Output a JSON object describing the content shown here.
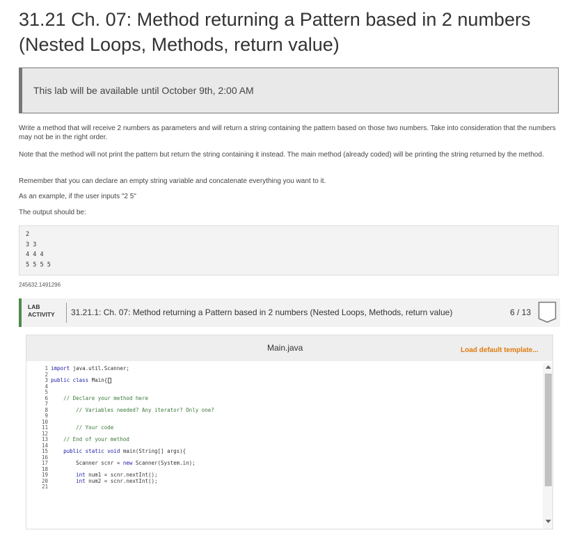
{
  "page": {
    "title_line1": "31.21 Ch. 07: Method returning a Pattern based in 2 numbers",
    "title_line2": "(Nested Loops, Methods, return value)"
  },
  "notice": {
    "text": "This lab will be available until October 9th, 2:00 AM"
  },
  "description": {
    "p1": "Write a method that will receive 2 numbers as parameters and will return a string containing the pattern based on those two numbers. Take into consideration that the numbers may not be in the right order.",
    "p2": "Note that the method will not print the pattern but return the string containing it instead. The main method (already coded) will be printing the string returned by the method.",
    "p3": "Remember that you can declare an empty string variable and concatenate everything you want to it.",
    "p4": "As an example, if the user inputs \"2 5\"",
    "p5": "The output should be:"
  },
  "example_output": [
    "2",
    "3 3",
    "4 4 4",
    "5 5 5 5"
  ],
  "lab_id": "245632.1491296",
  "lab": {
    "tag_line1": "LAB",
    "tag_line2": "ACTIVITY",
    "title": "31.21.1: Ch. 07: Method returning a Pattern based in 2 numbers (Nested Loops, Methods, return value)",
    "score": "6 / 13",
    "badge_icon": "ribbon-icon"
  },
  "editor": {
    "filename": "Main.java",
    "load_default": "Load default template...",
    "line_numbers": [
      "1",
      "2",
      "3",
      "4",
      "5",
      "6",
      "7",
      "8",
      "9",
      "10",
      "11",
      "12",
      "13",
      "14",
      "15",
      "16",
      "17",
      "18",
      "19",
      "20",
      "21"
    ],
    "lines": [
      "import java.util.Scanner;",
      "",
      "public class Main{",
      "",
      "",
      "    // Declare your method here",
      "",
      "        // Variables needed? Any iterator? Only one?",
      "",
      "",
      "        // Your code",
      "",
      "    // End of your method",
      "",
      "    public static void main(String[] args){",
      "",
      "        Scanner scnr = new Scanner(System.in);",
      "",
      "        int num1 = scnr.nextInt();",
      "        int num2 = scnr.nextInt();",
      ""
    ]
  },
  "colors": {
    "lab_accent": "#4c8b4a",
    "load_default": "#e07a10",
    "keyword": "#1a1aa6",
    "comment": "#3b7a3b"
  }
}
